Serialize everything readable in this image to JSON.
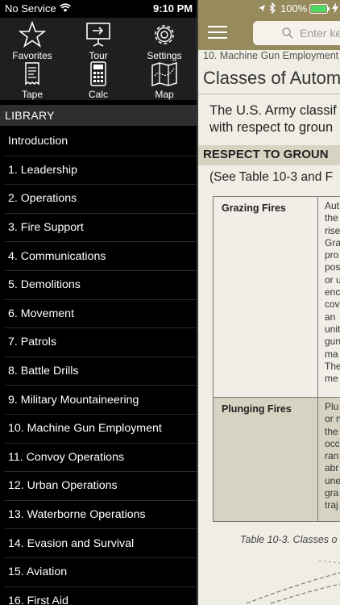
{
  "status_bar": {
    "carrier": "No Service",
    "time": "9:10 PM",
    "battery": "100%"
  },
  "toolbar": {
    "items": [
      {
        "label": "Favorites",
        "icon": "star-icon"
      },
      {
        "label": "Tour",
        "icon": "tour-icon"
      },
      {
        "label": "Settings",
        "icon": "gear-icon"
      },
      {
        "label": "Tape",
        "icon": "receipt-icon"
      },
      {
        "label": "Calc",
        "icon": "calculator-icon"
      },
      {
        "label": "Map",
        "icon": "map-icon"
      }
    ]
  },
  "sidebar": {
    "section_title": "LIBRARY",
    "chapters": [
      "Introduction",
      "1. Leadership",
      "2. Operations",
      "3. Fire Support",
      "4. Communications",
      "5. Demolitions",
      "6. Movement",
      "7. Patrols",
      "8. Battle Drills",
      "9. Military Mountaineering",
      "10. Machine Gun Employment",
      "11. Convoy Operations",
      "12. Urban Operations",
      "13. Waterborne Operations",
      "14. Evasion and Survival",
      "15. Aviation",
      "16. First Aid"
    ]
  },
  "header": {
    "search_placeholder": "Enter ke"
  },
  "content": {
    "breadcrumb": "10. Machine Gun Employment",
    "title": "Classes of Autom",
    "intro_line1": "The U.S. Army classif",
    "intro_line2": "with respect to groun",
    "section_heading": "RESPECT TO GROUN",
    "see_table": "(See Table 10-3 and F",
    "table": {
      "rows": [
        {
          "term": "Grazing Fires",
          "desc_lines": [
            "Aut",
            "the",
            "rise",
            "Gra",
            "pro",
            "pos",
            "or u",
            "enc",
            "cov",
            "an",
            "unit",
            "gun",
            "ma",
            "The",
            "me"
          ]
        },
        {
          "term": "Plunging Fires",
          "desc_lines": [
            "Plu",
            "or n",
            "the",
            "occ",
            "ran",
            "abr",
            "une",
            "gra",
            "traj"
          ]
        }
      ]
    },
    "caption": "Table 10-3. Classes o"
  }
}
